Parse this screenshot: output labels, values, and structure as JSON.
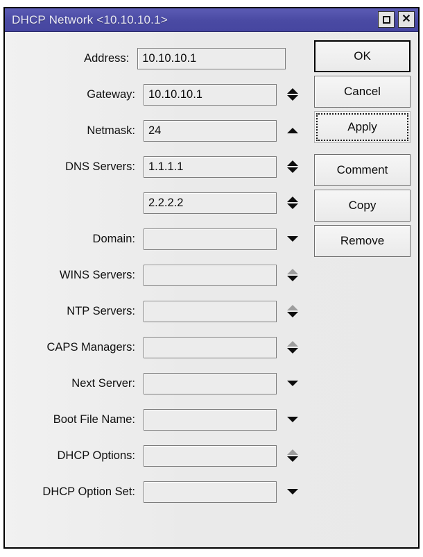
{
  "window": {
    "title": "DHCP Network <10.10.10.1>",
    "titlebar_color": "#4a4aa3",
    "controls": [
      {
        "name": "maximize",
        "glyph": "square"
      },
      {
        "name": "close",
        "glyph": "x"
      }
    ]
  },
  "form": {
    "rows": [
      {
        "label": "Address:",
        "value": "10.10.10.1",
        "field": "wide",
        "spinner": "none"
      },
      {
        "label": "Gateway:",
        "value": "10.10.10.1",
        "field": "narrow",
        "spinner": "up-down"
      },
      {
        "label": "Netmask:",
        "value": "24",
        "field": "narrow",
        "spinner": "up"
      },
      {
        "label": "DNS Servers:",
        "value": "1.1.1.1",
        "field": "narrow",
        "spinner": "up-down"
      },
      {
        "label": "",
        "value": "2.2.2.2",
        "field": "narrow",
        "spinner": "up-down"
      },
      {
        "label": "Domain:",
        "value": "",
        "field": "narrow",
        "spinner": "down"
      },
      {
        "label": "WINS Servers:",
        "value": "",
        "field": "narrow",
        "spinner": "up-dim-down"
      },
      {
        "label": "NTP Servers:",
        "value": "",
        "field": "narrow",
        "spinner": "up-dim-down"
      },
      {
        "label": "CAPS Managers:",
        "value": "",
        "field": "narrow",
        "spinner": "up-dim-down"
      },
      {
        "label": "Next Server:",
        "value": "",
        "field": "narrow",
        "spinner": "down"
      },
      {
        "label": "Boot File Name:",
        "value": "",
        "field": "narrow",
        "spinner": "down"
      },
      {
        "label": "DHCP Options:",
        "value": "",
        "field": "narrow",
        "spinner": "up-dim-down"
      },
      {
        "label": "DHCP Option Set:",
        "value": "",
        "field": "narrow",
        "spinner": "down"
      }
    ]
  },
  "buttons": {
    "ok": "OK",
    "cancel": "Cancel",
    "apply": "Apply",
    "comment": "Comment",
    "copy": "Copy",
    "remove": "Remove"
  }
}
